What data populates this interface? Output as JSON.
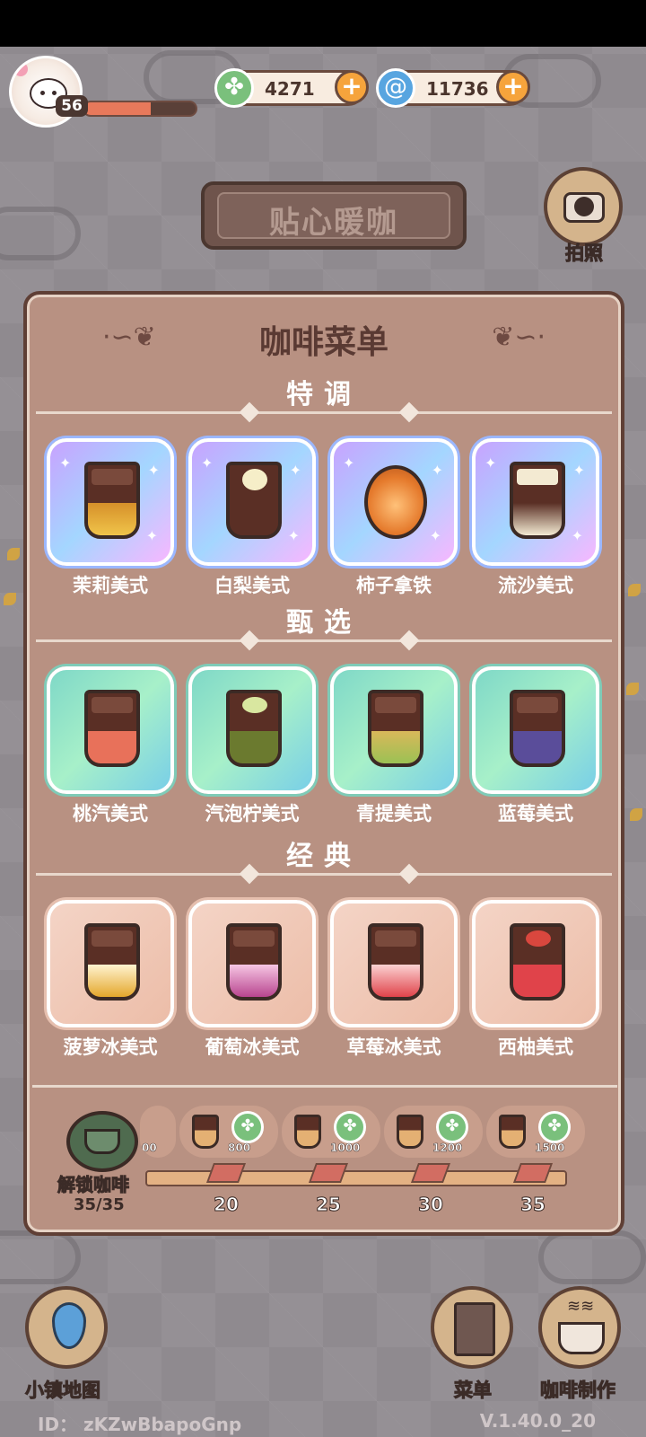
{
  "player": {
    "level": "56",
    "exp_fraction": 0.6
  },
  "currencies": [
    {
      "name": "clover",
      "value": "4271",
      "plus": "+"
    },
    {
      "name": "swirl",
      "value": "11736",
      "plus": "+"
    }
  ],
  "cafe_sign": "贴心暖咖",
  "camera": {
    "label": "拍照"
  },
  "menu": {
    "title": "咖啡菜单",
    "sections": [
      {
        "title": "特调",
        "items": [
          "茉莉美式",
          "白梨美式",
          "柿子拿铁",
          "流沙美式"
        ]
      },
      {
        "title": "甄选",
        "items": [
          "桃汽美式",
          "汽泡柠美式",
          "青提美式",
          "蓝莓美式"
        ]
      },
      {
        "title": "经典",
        "items": [
          "菠萝冰美式",
          "葡萄冰美式",
          "草莓冰美式",
          "西柚美式"
        ]
      }
    ]
  },
  "unlock": {
    "label": "解锁咖啡",
    "count": "35/35",
    "rewards": [
      "00",
      "800",
      "1000",
      "1200",
      "1500"
    ],
    "milestones": [
      "20",
      "25",
      "30",
      "35"
    ]
  },
  "nav": {
    "map": "小镇地图",
    "menu": "菜单",
    "make": "咖啡制作"
  },
  "footer": {
    "id": "ID： zKZwBbapoGnp",
    "version": "V.1.40.0_20"
  }
}
